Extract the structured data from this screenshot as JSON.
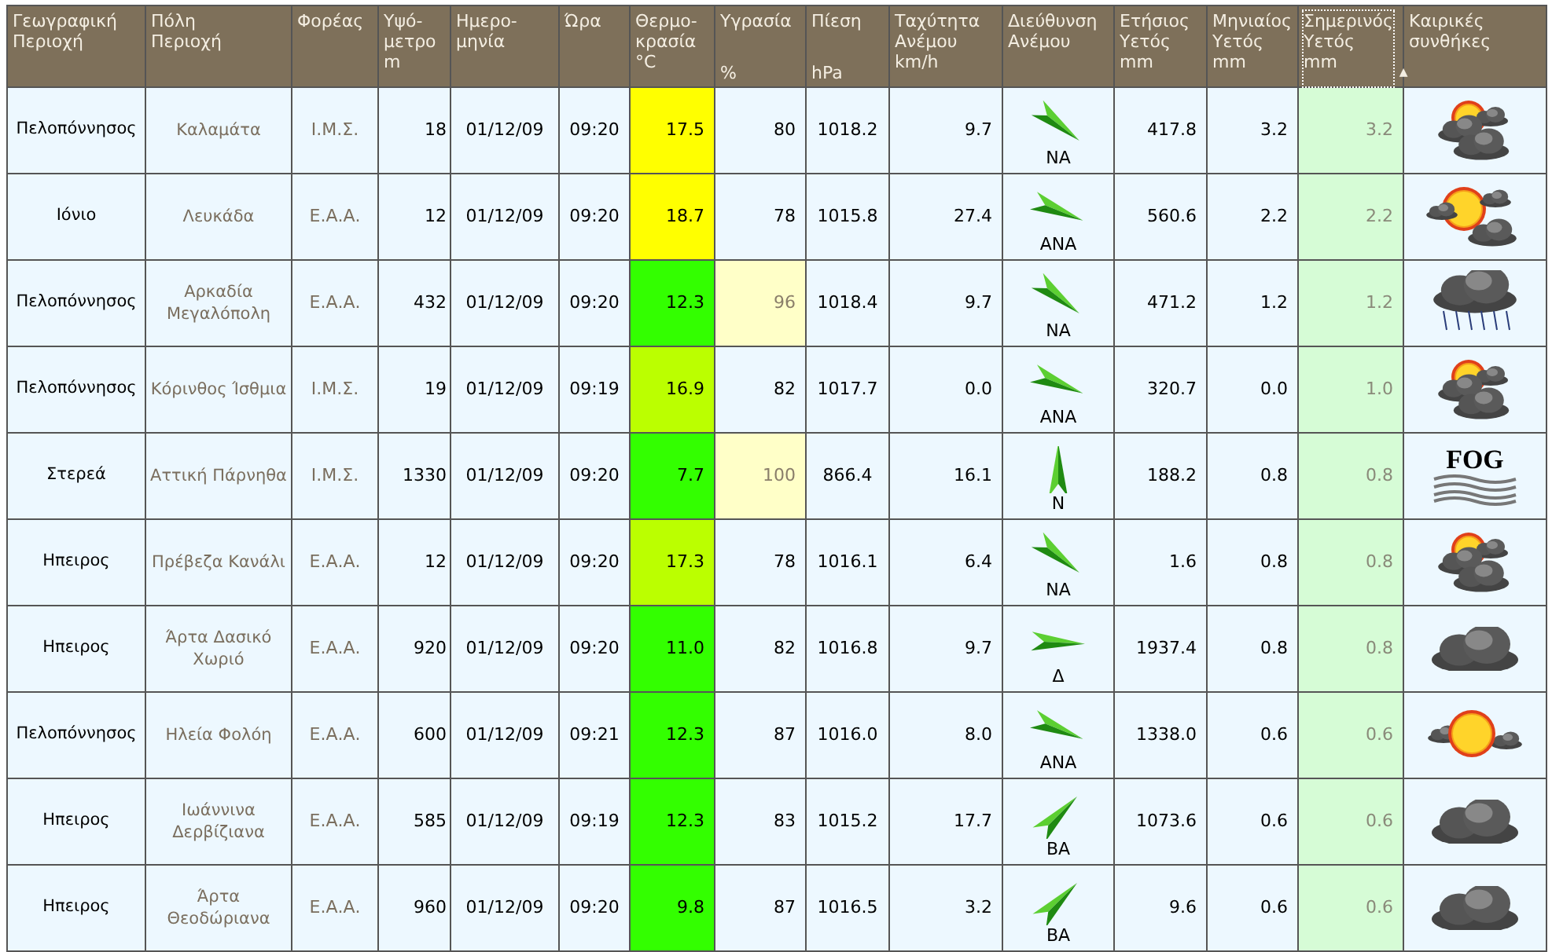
{
  "table": {
    "columns": [
      {
        "lines": [
          "Γεωγραφική",
          "Περιοχή"
        ],
        "sorted": false
      },
      {
        "lines": [
          "Πόλη",
          "Περιοχή"
        ],
        "sorted": false
      },
      {
        "lines": [
          "Φορέας"
        ],
        "sorted": false
      },
      {
        "lines": [
          "Υψό-",
          "μετρο",
          "m"
        ],
        "sorted": false
      },
      {
        "lines": [
          "Ημερο-",
          "μηνία"
        ],
        "sorted": false
      },
      {
        "lines": [
          "Ώρα"
        ],
        "sorted": false
      },
      {
        "lines": [
          "Θερμο-",
          "κρασία",
          "°C"
        ],
        "sorted": false
      },
      {
        "lines": [
          "Υγρασία"
        ],
        "unit": "%",
        "sorted": false
      },
      {
        "lines": [
          "Πίεση"
        ],
        "unit": "hPa",
        "sorted": false
      },
      {
        "lines": [
          "Ταχύτητα",
          "Ανέμου",
          "km/h"
        ],
        "sorted": false
      },
      {
        "lines": [
          "Διεύθυνση",
          "Ανέμου"
        ],
        "sorted": false
      },
      {
        "lines": [
          "Ετήσιος",
          "Υετός",
          "mm"
        ],
        "sorted": false
      },
      {
        "lines": [
          "Μηνιαίος",
          "Υετός",
          "mm"
        ],
        "sorted": false
      },
      {
        "lines": [
          "Σημερινός",
          "Υετός",
          "mm"
        ],
        "sorted": true,
        "sort_indicator": "▲"
      },
      {
        "lines": [
          "Καιρικές",
          "συνθήκες"
        ],
        "sorted": false
      }
    ],
    "rows": [
      {
        "region": "Πελοπόννησος",
        "city": "Καλαμάτα",
        "operator": "Ι.Μ.Σ.",
        "altitude": "18",
        "date": "01/12/09",
        "time": "09:20",
        "temperature": {
          "value": "17.5",
          "color": "#ffff00"
        },
        "humidity": {
          "value": "80",
          "high": false
        },
        "pressure": "1018.2",
        "wind_speed": "9.7",
        "wind_direction": {
          "label": "NA",
          "kind": "southeast"
        },
        "annual_rain": "417.8",
        "monthly_rain": "3.2",
        "today_rain": "3.2",
        "conditions": {
          "kind": "sun_behind_clouds"
        }
      },
      {
        "region": "Ιόνιο",
        "city": "Λευκάδα",
        "operator": "Ε.Α.Α.",
        "altitude": "12",
        "date": "01/12/09",
        "time": "09:20",
        "temperature": {
          "value": "18.7",
          "color": "#ffff00"
        },
        "humidity": {
          "value": "78",
          "high": false
        },
        "pressure": "1015.8",
        "wind_speed": "27.4",
        "wind_direction": {
          "label": "ANA",
          "kind": "east_southeast"
        },
        "annual_rain": "560.6",
        "monthly_rain": "2.2",
        "today_rain": "2.2",
        "conditions": {
          "kind": "sun_and_clouds"
        }
      },
      {
        "region": "Πελοπόννησος",
        "city": "Αρκαδία Μεγαλόπολη",
        "operator": "Ε.Α.Α.",
        "altitude": "432",
        "date": "01/12/09",
        "time": "09:20",
        "temperature": {
          "value": "12.3",
          "color": "#33ff00"
        },
        "humidity": {
          "value": "96",
          "high": true
        },
        "pressure": "1018.4",
        "wind_speed": "9.7",
        "wind_direction": {
          "label": "NA",
          "kind": "southeast"
        },
        "annual_rain": "471.2",
        "monthly_rain": "1.2",
        "today_rain": "1.2",
        "conditions": {
          "kind": "rain"
        }
      },
      {
        "region": "Πελοπόννησος",
        "city": "Κόρινθος Ίσθμια",
        "operator": "Ι.Μ.Σ.",
        "altitude": "19",
        "date": "01/12/09",
        "time": "09:19",
        "temperature": {
          "value": "16.9",
          "color": "#bbff00"
        },
        "humidity": {
          "value": "82",
          "high": false
        },
        "pressure": "1017.7",
        "wind_speed": "0.0",
        "wind_direction": {
          "label": "ANA",
          "kind": "east_southeast"
        },
        "annual_rain": "320.7",
        "monthly_rain": "0.0",
        "today_rain": "1.0",
        "conditions": {
          "kind": "sun_behind_clouds"
        }
      },
      {
        "region": "Στερεά",
        "city": "Αττική Πάρνηθα",
        "operator": "Ι.Μ.Σ.",
        "altitude": "1330",
        "date": "01/12/09",
        "time": "09:20",
        "temperature": {
          "value": "7.7",
          "color": "#33ff00"
        },
        "humidity": {
          "value": "100",
          "high": true
        },
        "pressure": "866.4",
        "wind_speed": "16.1",
        "wind_direction": {
          "label": "N",
          "kind": "north"
        },
        "annual_rain": "188.2",
        "monthly_rain": "0.8",
        "today_rain": "0.8",
        "conditions": {
          "kind": "fog",
          "text": "FOG"
        }
      },
      {
        "region": "Ηπειρος",
        "city": "Πρέβεζα Κανάλι",
        "operator": "Ε.Α.Α.",
        "altitude": "12",
        "date": "01/12/09",
        "time": "09:20",
        "temperature": {
          "value": "17.3",
          "color": "#bbff00"
        },
        "humidity": {
          "value": "78",
          "high": false
        },
        "pressure": "1016.1",
        "wind_speed": "6.4",
        "wind_direction": {
          "label": "NA",
          "kind": "southeast"
        },
        "annual_rain": "1.6",
        "monthly_rain": "0.8",
        "today_rain": "0.8",
        "conditions": {
          "kind": "sun_behind_clouds"
        }
      },
      {
        "region": "Ηπειρος",
        "city": "Άρτα Δασικό Χωριό",
        "operator": "Ε.Α.Α.",
        "altitude": "920",
        "date": "01/12/09",
        "time": "09:20",
        "temperature": {
          "value": "11.0",
          "color": "#33ff00"
        },
        "humidity": {
          "value": "82",
          "high": false
        },
        "pressure": "1016.8",
        "wind_speed": "9.7",
        "wind_direction": {
          "label": "Δ",
          "kind": "east"
        },
        "annual_rain": "1937.4",
        "monthly_rain": "0.8",
        "today_rain": "0.8",
        "conditions": {
          "kind": "cloudy"
        }
      },
      {
        "region": "Πελοπόννησος",
        "city": "Ηλεία Φολόη",
        "operator": "Ε.Α.Α.",
        "altitude": "600",
        "date": "01/12/09",
        "time": "09:21",
        "temperature": {
          "value": "12.3",
          "color": "#33ff00"
        },
        "humidity": {
          "value": "87",
          "high": false
        },
        "pressure": "1016.0",
        "wind_speed": "8.0",
        "wind_direction": {
          "label": "ANA",
          "kind": "east_southeast"
        },
        "annual_rain": "1338.0",
        "monthly_rain": "0.6",
        "today_rain": "0.6",
        "conditions": {
          "kind": "sunny"
        }
      },
      {
        "region": "Ηπειρος",
        "city": "Ιωάννινα Δερβίζιανα",
        "operator": "Ε.Α.Α.",
        "altitude": "585",
        "date": "01/12/09",
        "time": "09:19",
        "temperature": {
          "value": "12.3",
          "color": "#33ff00"
        },
        "humidity": {
          "value": "83",
          "high": false
        },
        "pressure": "1015.2",
        "wind_speed": "17.7",
        "wind_direction": {
          "label": "BA",
          "kind": "northeast"
        },
        "annual_rain": "1073.6",
        "monthly_rain": "0.6",
        "today_rain": "0.6",
        "conditions": {
          "kind": "cloudy"
        }
      },
      {
        "region": "Ηπειρος",
        "city": "Άρτα Θεοδώριανα",
        "operator": "Ε.Α.Α.",
        "altitude": "960",
        "date": "01/12/09",
        "time": "09:20",
        "temperature": {
          "value": "9.8",
          "color": "#33ff00"
        },
        "humidity": {
          "value": "87",
          "high": false
        },
        "pressure": "1016.5",
        "wind_speed": "3.2",
        "wind_direction": {
          "label": "BA",
          "kind": "northeast"
        },
        "annual_rain": "9.6",
        "monthly_rain": "0.6",
        "today_rain": "0.6",
        "conditions": {
          "kind": "cloudy"
        }
      }
    ]
  }
}
